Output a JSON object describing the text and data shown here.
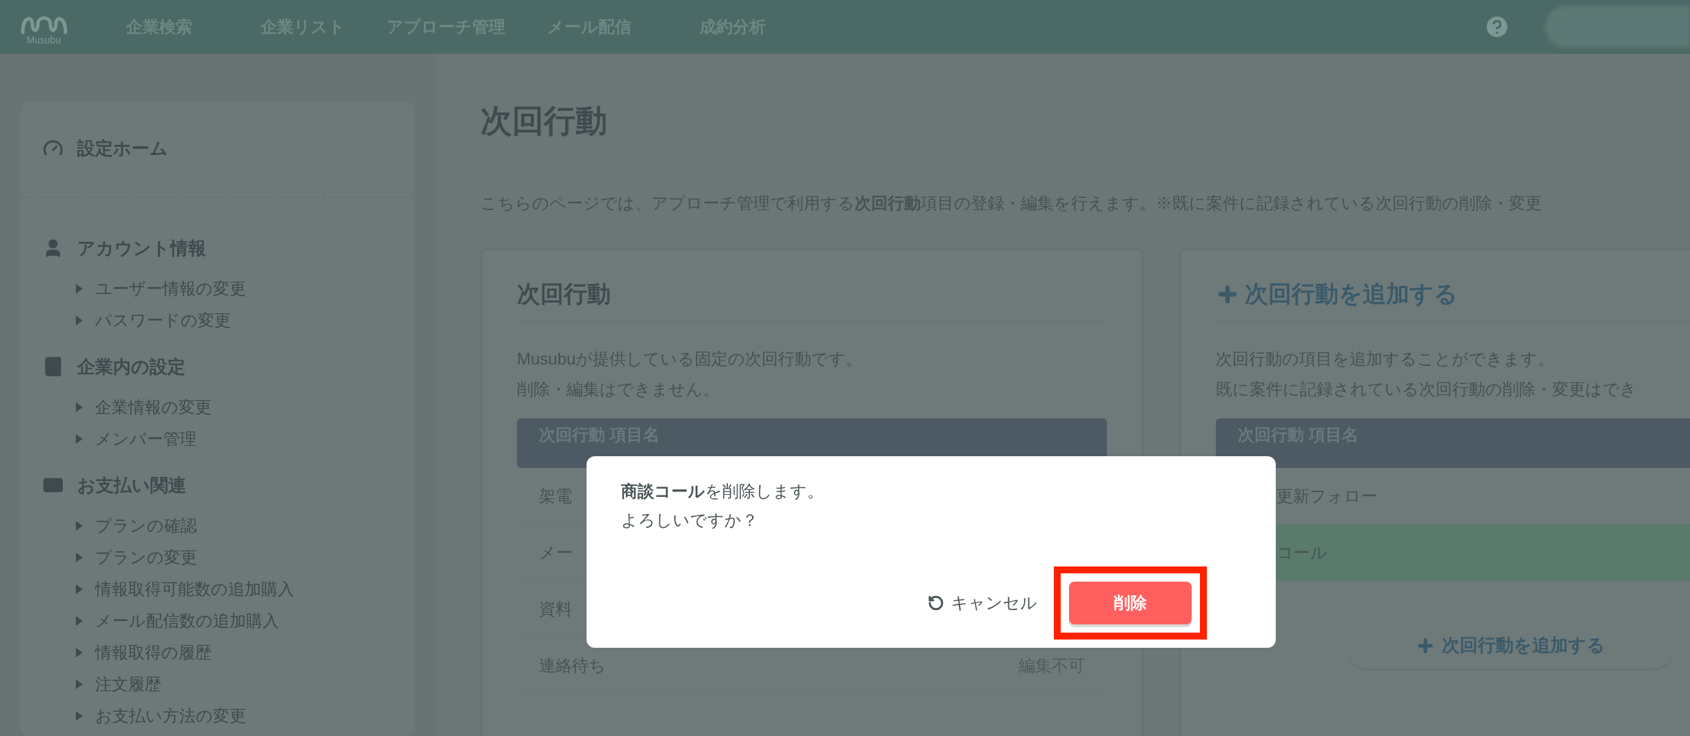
{
  "nav": {
    "logo_text": "Musubu",
    "items": [
      "企業検索",
      "企業リスト",
      "アプローチ管理",
      "メール配信",
      "成約分析"
    ]
  },
  "sidebar": [
    {
      "kind": "home",
      "title": "設定ホーム"
    },
    {
      "kind": "account",
      "title": "アカウント情報",
      "children": [
        "ユーザー情報の変更",
        "パスワードの変更"
      ]
    },
    {
      "kind": "company",
      "title": "企業内の設定",
      "children": [
        "企業情報の変更",
        "メンバー管理"
      ]
    },
    {
      "kind": "payment",
      "title": "お支払い関連",
      "children": [
        "プランの確認",
        "プランの変更",
        "情報取得可能数の追加購入",
        "メール配信数の追加購入",
        "情報取得の履歴",
        "注文履歴",
        "お支払い方法の変更"
      ]
    }
  ],
  "page": {
    "title": "次回行動",
    "description": "こちらのページでは、アプローチ管理で利用する**次回行動**項目の登録・編集を行えます。",
    "note": "※既に案件に記録されている次回行動の削除・変更"
  },
  "fixed_card": {
    "title": "次回行動",
    "lines": [
      "Musubuが提供している固定の次回行動です。",
      "削除・編集はできません。"
    ],
    "table_header": "次回行動 項目名",
    "rows": [
      {
        "name": "架電"
      },
      {
        "name": "メー"
      },
      {
        "name": "資料"
      },
      {
        "name": "連絡待ち",
        "status": "編集不可"
      }
    ]
  },
  "custom_card": {
    "title": "次回行動を追加する",
    "lines": [
      "次回行動の項目を追加することができます。",
      "既に案件に記録されている次回行動の削除・変更はでき"
    ],
    "table_header": "次回行動 項目名",
    "rows": [
      {
        "name": "更新フォロー",
        "selected": false
      },
      {
        "name": "コール",
        "selected": true
      }
    ],
    "add_button": "次回行動を追加する"
  },
  "dialog": {
    "lines": [
      "**商談コール**を削除します。",
      "よろしいですか？"
    ],
    "cancel": "キャンセル",
    "delete": "削除"
  }
}
